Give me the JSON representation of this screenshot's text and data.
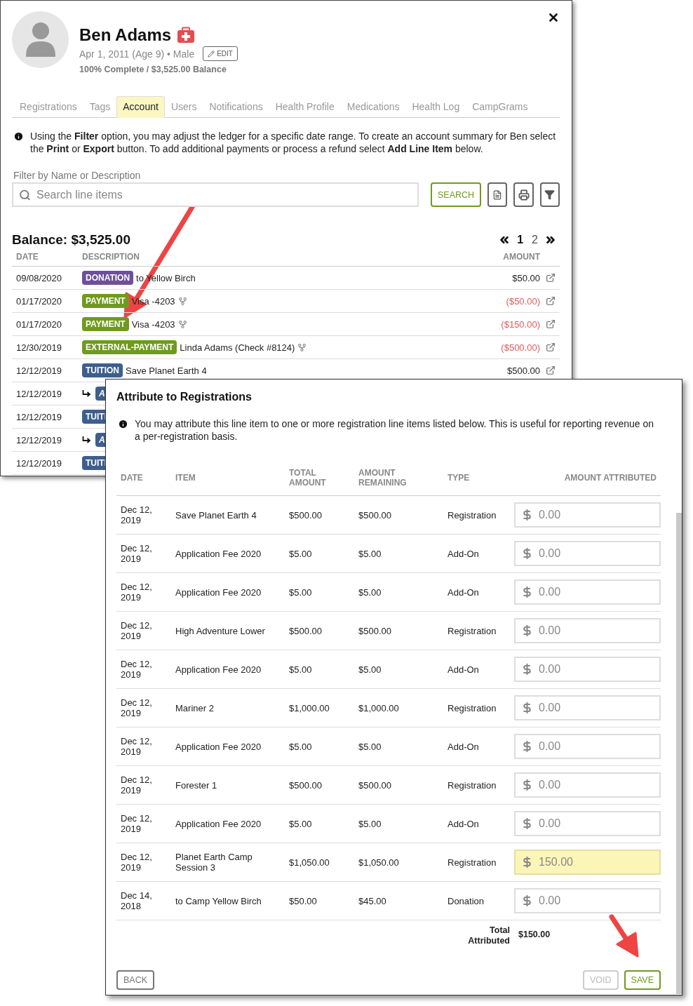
{
  "profile": {
    "name": "Ben Adams",
    "details": "Apr 1, 2011 (Age 9) • Male",
    "edit_button": "EDIT",
    "summary": "100% Complete / $3,525.00 Balance"
  },
  "tabs": [
    {
      "label": "Registrations",
      "selected": false
    },
    {
      "label": "Tags",
      "selected": false
    },
    {
      "label": "Account",
      "selected": true
    },
    {
      "label": "Users",
      "selected": false
    },
    {
      "label": "Notifications",
      "selected": false
    },
    {
      "label": "Health Profile",
      "selected": false
    },
    {
      "label": "Medications",
      "selected": false
    },
    {
      "label": "Health Log",
      "selected": false
    },
    {
      "label": "CampGrams",
      "selected": false
    }
  ],
  "info": "Using the **Filter** option, you may adjust the ledger for a specific date range. To create an account summary for Ben select the **Print** or **Export** button. To add additional payments or process a refund select **Add Line Item** below.",
  "filter": {
    "label": "Filter by Name or Description",
    "placeholder": "Search line items",
    "search_button": "SEARCH"
  },
  "balance": "Balance: $3,525.00",
  "pager": [
    {
      "label": "1",
      "selected": true
    },
    {
      "label": "2",
      "selected": false
    }
  ],
  "ledger": {
    "columns": [
      "DATE",
      "DESCRIPTION",
      "AMOUNT"
    ],
    "rows": [
      {
        "kind": "full",
        "date": "09/08/2020",
        "badge": "DONATION",
        "color": "#6e4f9b",
        "description": "to Yellow Birch",
        "split": false,
        "amount": "$50.00",
        "negative": false
      },
      {
        "kind": "full",
        "date": "01/17/2020",
        "badge": "PAYMENT",
        "color": "#6f9a1f",
        "description": "Visa -4203",
        "split": true,
        "amount": "($50.00)",
        "negative": true
      },
      {
        "kind": "full",
        "date": "01/17/2020",
        "badge": "PAYMENT",
        "color": "#6f9a1f",
        "description": "Visa -4203",
        "split": true,
        "amount": "($150.00)",
        "negative": true
      },
      {
        "kind": "full",
        "date": "12/30/2019",
        "badge": "EXTERNAL-PAYMENT",
        "color": "#6f9a1f",
        "description": "Linda Adams (Check #8124)",
        "split": true,
        "amount": "($500.00)",
        "negative": true
      },
      {
        "kind": "full",
        "date": "12/12/2019",
        "badge": "TUITION",
        "color": "#3e5f8c",
        "description": "Save Planet Earth 4",
        "split": false,
        "amount": "$500.00",
        "negative": false
      },
      {
        "kind": "sub",
        "date": "12/12/2019",
        "badge": "A",
        "color": "#3e5f8c"
      },
      {
        "kind": "cut",
        "date": "12/12/2019",
        "badge": "TUITI",
        "color": "#3e5f8c"
      },
      {
        "kind": "sub",
        "date": "12/12/2019",
        "badge": "A",
        "color": "#3e5f8c"
      },
      {
        "kind": "cut",
        "date": "12/12/2019",
        "badge": "TUITI",
        "color": "#3e5f8c"
      }
    ]
  },
  "dialog": {
    "title": "Attribute to Registrations",
    "info": "You may attribute this line item to one or more registration line items listed below. This is useful for reporting revenue on a per-registration basis.",
    "columns": [
      "DATE",
      "ITEM",
      "TOTAL AMOUNT",
      "AMOUNT REMAINING",
      "TYPE",
      "AMOUNT ATTRIBUTED"
    ],
    "rows": [
      {
        "date": "Dec 12, 2019",
        "item": "Save Planet Earth 4",
        "total": "$500.00",
        "remaining": "$500.00",
        "type": "Registration",
        "amount": "0.00",
        "highlighted": false
      },
      {
        "date": "Dec 12, 2019",
        "item": "Application Fee 2020",
        "total": "$5.00",
        "remaining": "$5.00",
        "type": "Add-On",
        "amount": "0.00",
        "highlighted": false
      },
      {
        "date": "Dec 12, 2019",
        "item": "Application Fee 2020",
        "total": "$5.00",
        "remaining": "$5.00",
        "type": "Add-On",
        "amount": "0.00",
        "highlighted": false
      },
      {
        "date": "Dec 12, 2019",
        "item": "High Adventure Lower",
        "total": "$500.00",
        "remaining": "$500.00",
        "type": "Registration",
        "amount": "0.00",
        "highlighted": false
      },
      {
        "date": "Dec 12, 2019",
        "item": "Application Fee 2020",
        "total": "$5.00",
        "remaining": "$5.00",
        "type": "Add-On",
        "amount": "0.00",
        "highlighted": false
      },
      {
        "date": "Dec 12, 2019",
        "item": "Mariner 2",
        "total": "$1,000.00",
        "remaining": "$1,000.00",
        "type": "Registration",
        "amount": "0.00",
        "highlighted": false
      },
      {
        "date": "Dec 12, 2019",
        "item": "Application Fee 2020",
        "total": "$5.00",
        "remaining": "$5.00",
        "type": "Add-On",
        "amount": "0.00",
        "highlighted": false
      },
      {
        "date": "Dec 12, 2019",
        "item": "Forester 1",
        "total": "$500.00",
        "remaining": "$500.00",
        "type": "Registration",
        "amount": "0.00",
        "highlighted": false
      },
      {
        "date": "Dec 12, 2019",
        "item": "Application Fee 2020",
        "total": "$5.00",
        "remaining": "$5.00",
        "type": "Add-On",
        "amount": "0.00",
        "highlighted": false
      },
      {
        "date": "Dec 12, 2019",
        "item": "Planet Earth Camp Session 3",
        "total": "$1,050.00",
        "remaining": "$1,050.00",
        "type": "Registration",
        "amount": "150.00",
        "highlighted": true
      },
      {
        "date": "Dec 14, 2018",
        "item": "to Camp Yellow Birch",
        "total": "$50.00",
        "remaining": "$45.00",
        "type": "Donation",
        "amount": "0.00",
        "highlighted": false
      }
    ],
    "total_label": "Total Attributed",
    "total": "$150.00",
    "buttons": [
      {
        "label": "BACK",
        "kind": "back",
        "disabled": false
      },
      {
        "label": "VOID",
        "kind": "action",
        "disabled": true
      },
      {
        "label": "SAVE",
        "kind": "action",
        "disabled": false
      }
    ]
  }
}
